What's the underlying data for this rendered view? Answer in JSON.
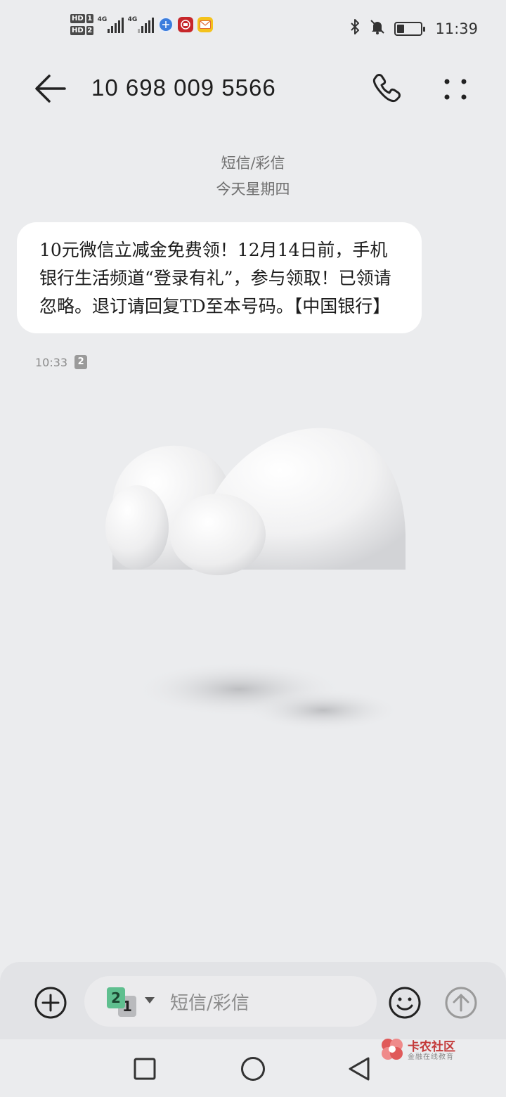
{
  "status_bar": {
    "hd1": "HD",
    "hd1_num": "1",
    "hd2": "HD",
    "hd2_num": "2",
    "net1": "4G",
    "net2": "4G",
    "time": "11:39",
    "battery_level_percent": 30,
    "icons": [
      "bluetooth-icon",
      "mute-icon",
      "battery-icon"
    ]
  },
  "header": {
    "back_icon": "arrow-left-icon",
    "contact": "10 698 009 5566",
    "call_icon": "phone-icon",
    "more_icon": "more-dots-icon"
  },
  "thread_meta": {
    "type": "短信/彩信",
    "day": "今天星期四"
  },
  "message": {
    "text": "10元微信立减金免费领！12月14日前，手机银行生活频道“登录有礼”，参与领取！已领请忽略。退订请回复TD至本号码。【中国银行】",
    "time": "10:33",
    "sim": "2"
  },
  "composer": {
    "add_icon": "plus-circle-icon",
    "sim_front": "2",
    "sim_back": "1",
    "placeholder": "短信/彩信",
    "emoji_icon": "smiley-icon",
    "send_icon": "send-arrow-icon"
  },
  "navbar": {
    "icons": [
      "recent-apps-icon",
      "home-icon",
      "back-triangle-icon"
    ]
  },
  "watermark": {
    "title": "卡农社区",
    "subtitle": "金融在线教育"
  },
  "colors": {
    "background": "#ebecee",
    "bubble": "#ffffff",
    "sim2": "#5fbf8f",
    "watermark": "#c43a3a"
  }
}
